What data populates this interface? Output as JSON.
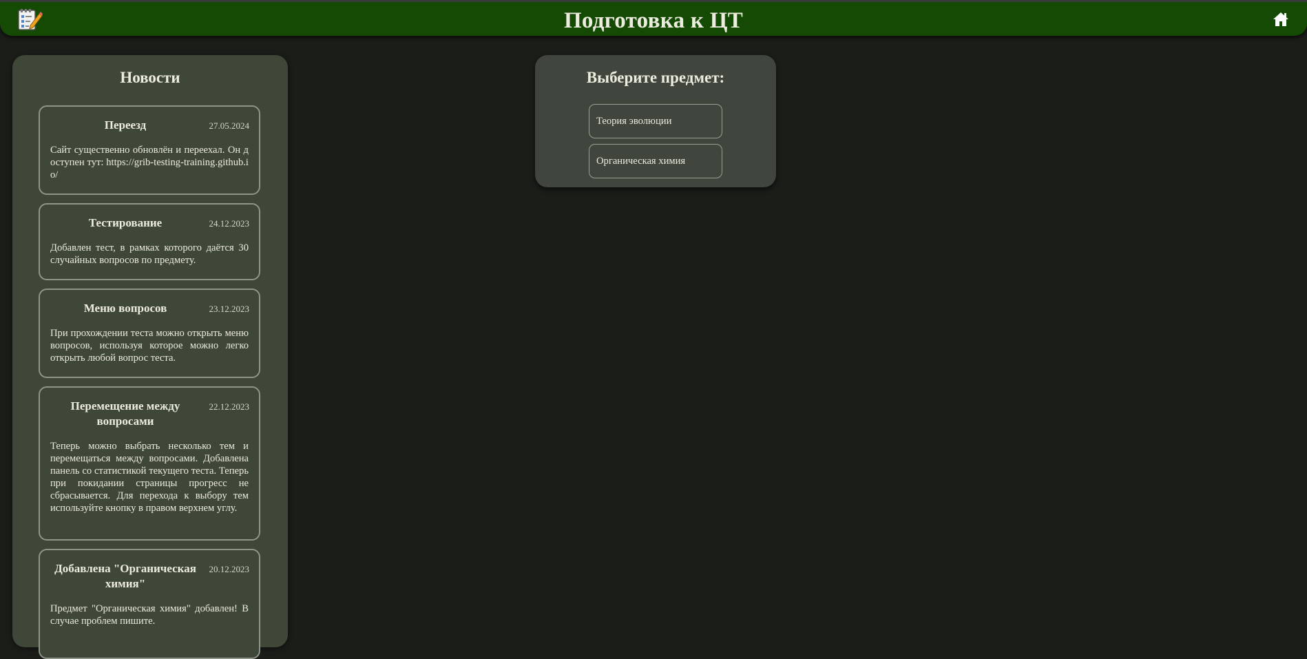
{
  "header": {
    "title": "Подготовка к ЦТ",
    "logo_icon": "notepad-pencil-icon",
    "home_icon": "home-icon"
  },
  "news": {
    "heading": "Новости",
    "items": [
      {
        "title": "Переезд",
        "date": "27.05.2024",
        "text": "Сайт существенно обновлён и переехал. Он доступен тут: https://grib-testing-training.github.io/"
      },
      {
        "title": "Тестирование",
        "date": "24.12.2023",
        "text": "Добавлен тест, в рамках которого даётся 30 случайных вопросов по предмету."
      },
      {
        "title": "Меню вопросов",
        "date": "23.12.2023",
        "text": "При прохождении теста можно открыть меню вопросов, используя которое можно легко открыть любой вопрос теста."
      },
      {
        "title": "Перемещение между вопросами",
        "date": "22.12.2023",
        "text": "Теперь можно выбрать несколько тем и перемещаться между вопросами. Добавлена панель со статистикой текущего теста. Теперь при покидании страницы прогресс не сбрасывается. Для перехода к выбору тем используйте кнопку в правом верхнем углу."
      },
      {
        "title": "Добавлена \"Органическая химия\"",
        "date": "20.12.2023",
        "text": "Предмет \"Органическая химия\" добавлен! В случае проблем пишите."
      }
    ]
  },
  "subjects": {
    "heading": "Выберите предмет:",
    "options": [
      "Теория эволюции",
      "Органическая химия"
    ]
  },
  "colors": {
    "header_bg": "#144a04",
    "page_bg": "#1b1d19",
    "panel_bg": "#3f4738"
  }
}
